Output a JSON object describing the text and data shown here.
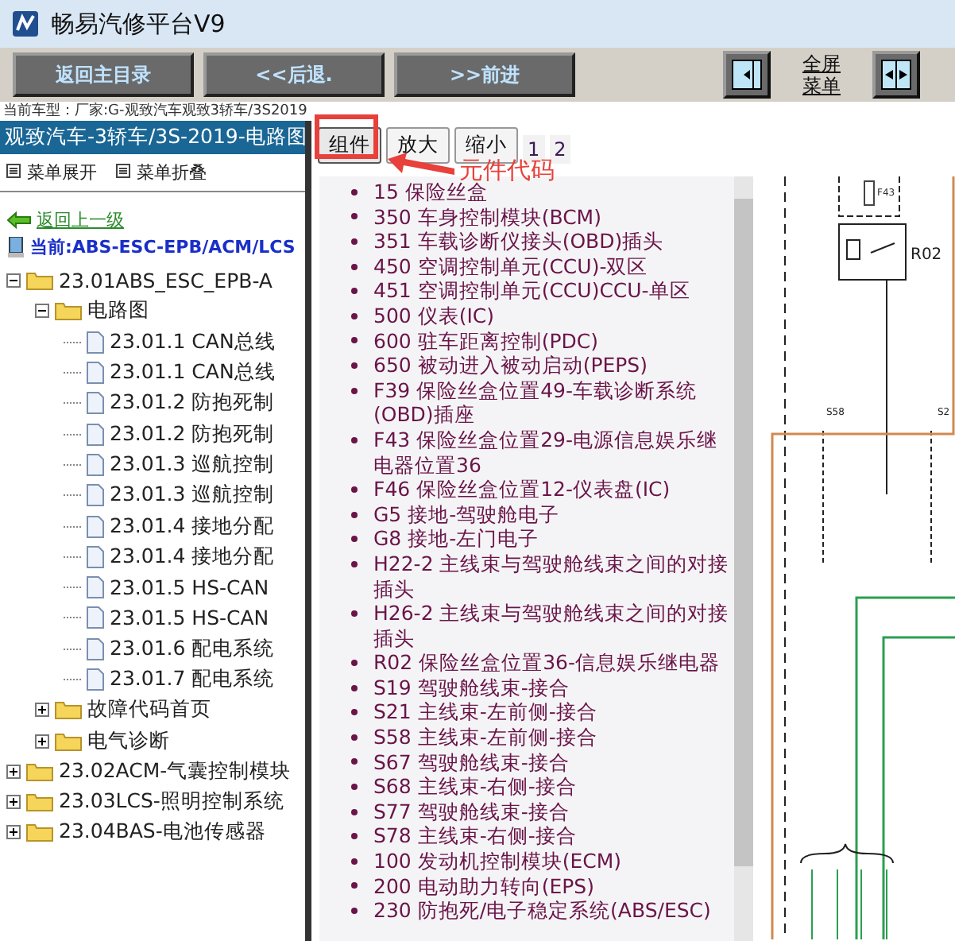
{
  "window": {
    "title": "畅易汽修平台V9"
  },
  "toolbar": {
    "buttons": [
      "返回主目录",
      "<<后退.",
      ">>前进"
    ],
    "fullscreen_link": [
      "全屏",
      "菜单"
    ]
  },
  "car_model": "当前车型：厂家:G-观致汽车观致3轿车/3S2019",
  "sidebar": {
    "header": "观致汽车-3轿车/3S-2019-电路图",
    "menu_actions": [
      "菜单展开",
      "菜单折叠"
    ],
    "back_link": "返回上一级",
    "current": "当前:ABS-ESC-EPB/ACM/LCS",
    "tree": [
      {
        "label": "23.01ABS_ESC_EPB-A",
        "kind": "folder",
        "expanded": true,
        "children": [
          {
            "label": "电路图",
            "kind": "folder",
            "expanded": true,
            "children": [
              {
                "label": "23.01.1 CAN总线",
                "kind": "page"
              },
              {
                "label": "23.01.1 CAN总线",
                "kind": "page"
              },
              {
                "label": "23.01.2 防抱死制",
                "kind": "page"
              },
              {
                "label": "23.01.2 防抱死制",
                "kind": "page"
              },
              {
                "label": "23.01.3 巡航控制",
                "kind": "page"
              },
              {
                "label": "23.01.3 巡航控制",
                "kind": "page"
              },
              {
                "label": "23.01.4 接地分配",
                "kind": "page"
              },
              {
                "label": "23.01.4 接地分配",
                "kind": "page"
              },
              {
                "label": "23.01.5 HS-CAN",
                "kind": "page"
              },
              {
                "label": "23.01.5 HS-CAN",
                "kind": "page"
              },
              {
                "label": "23.01.6 配电系统",
                "kind": "page"
              },
              {
                "label": "23.01.7 配电系统",
                "kind": "page"
              }
            ]
          },
          {
            "label": "故障代码首页",
            "kind": "folder",
            "expanded": false
          },
          {
            "label": "电气诊断",
            "kind": "folder",
            "expanded": false
          }
        ]
      },
      {
        "label": "23.02ACM-气囊控制模块",
        "kind": "folder",
        "expanded": false
      },
      {
        "label": "23.03LCS-照明控制系统",
        "kind": "folder",
        "expanded": false
      },
      {
        "label": "23.04BAS-电池传感器",
        "kind": "folder",
        "expanded": false
      }
    ]
  },
  "tabs": [
    {
      "label": "组件",
      "selected": true
    },
    {
      "label": "放大",
      "selected": false
    },
    {
      "label": "缩小",
      "selected": false
    }
  ],
  "pages": [
    "1",
    "2"
  ],
  "annotation": "元件代码",
  "components": [
    "15 保险丝盒",
    "350 车身控制模块(BCM)",
    "351 车载诊断仪接头(OBD)插头",
    "450 空调控制单元(CCU)-双区",
    "451 空调控制单元(CCU)CCU-单区",
    "500 仪表(IC)",
    "600 驻车距离控制(PDC)",
    "650 被动进入被动启动(PEPS)",
    "F39 保险丝盒位置49-车载诊断系统(OBD)插座",
    "F43 保险丝盒位置29-电源信息娱乐继电器位置36",
    "F46 保险丝盒位置12-仪表盘(IC)",
    "G5 接地-驾驶舱电子",
    "G8 接地-左门电子",
    "H22-2 主线束与驾驶舱线束之间的对接插头",
    "H26-2 主线束与驾驶舱线束之间的对接插头",
    "R02 保险丝盒位置36-信息娱乐继电器",
    "S19 驾驶舱线束-接合",
    "S21 主线束-左前侧-接合",
    "S58 主线束-左前侧-接合",
    "S67 驾驶舱线束-接合",
    "S68 主线束-右侧-接合",
    "S77 驾驶舱线束-接合",
    "S78 主线束-右侧-接合",
    "100 发动机控制模块(ECM)",
    "200 电动助力转向(EPS)",
    "230 防抱死/电子稳定系统(ABS/ESC)"
  ],
  "diagram": {
    "labels": [
      "F43",
      "R02",
      "S58",
      "S2"
    ]
  }
}
